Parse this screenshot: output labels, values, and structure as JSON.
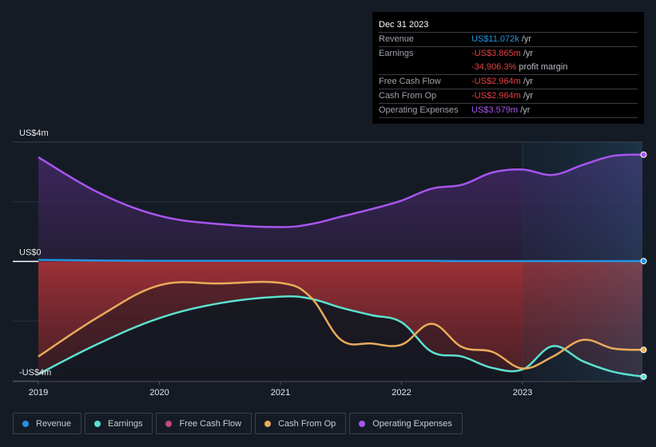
{
  "tooltip": {
    "date": "Dec 31 2023",
    "rows": [
      {
        "label": "Revenue",
        "value": "US$11.072k",
        "suffix": " /yr",
        "color": "#2394df"
      },
      {
        "label": "Earnings",
        "value": "-US$3.865m",
        "suffix": " /yr",
        "color": "#e64141"
      },
      {
        "label": "",
        "value": "-34,906.3%",
        "suffix": " profit margin",
        "color": "#e64141"
      },
      {
        "label": "Free Cash Flow",
        "value": "-US$2.964m",
        "suffix": " /yr",
        "color": "#e64141"
      },
      {
        "label": "Cash From Op",
        "value": "-US$2.964m",
        "suffix": " /yr",
        "color": "#e64141"
      },
      {
        "label": "Operating Expenses",
        "value": "US$3.579m",
        "suffix": " /yr",
        "color": "#a855f0"
      }
    ]
  },
  "legend": [
    {
      "label": "Revenue",
      "color": "#2394df"
    },
    {
      "label": "Earnings",
      "color": "#5ce1d0"
    },
    {
      "label": "Free Cash Flow",
      "color": "#c4467f"
    },
    {
      "label": "Cash From Op",
      "color": "#e9ac5b"
    },
    {
      "label": "Operating Expenses",
      "color": "#a855f0"
    }
  ],
  "chart_data": {
    "type": "area",
    "title": "",
    "xlabel": "",
    "ylabel": "",
    "ylim": [
      -4,
      4
    ],
    "yunit": "US$ millions",
    "y_tick_labels": [
      {
        "value": 4,
        "label": "US$4m"
      },
      {
        "value": 0,
        "label": "US$0"
      },
      {
        "value": -4,
        "label": "-US$4m"
      }
    ],
    "xlim": [
      2019,
      2024
    ],
    "x_tick_labels": [
      "2019",
      "2020",
      "2021",
      "2022",
      "2023"
    ],
    "x_tick_values": [
      2019,
      2020,
      2021,
      2022,
      2023
    ],
    "grid": true,
    "highlight_from": 2023,
    "x": [
      2019.0,
      2019.5,
      2020.0,
      2020.5,
      2021.0,
      2021.25,
      2021.5,
      2021.75,
      2022.0,
      2022.25,
      2022.5,
      2022.75,
      2023.0,
      2023.25,
      2023.5,
      2023.75,
      2024.0
    ],
    "series": [
      {
        "name": "Revenue",
        "color": "#2394df",
        "values": [
          0.05,
          0.03,
          0.02,
          0.02,
          0.02,
          0.02,
          0.02,
          0.02,
          0.02,
          0.02,
          0.01,
          0.01,
          0.01,
          0.01,
          0.01,
          0.01,
          0.011
        ]
      },
      {
        "name": "Earnings",
        "color": "#5ce1d0",
        "values": [
          -3.78,
          -2.75,
          -1.9,
          -1.4,
          -1.18,
          -1.25,
          -1.55,
          -1.8,
          -2.04,
          -3.03,
          -3.19,
          -3.57,
          -3.62,
          -2.84,
          -3.35,
          -3.7,
          -3.865
        ]
      },
      {
        "name": "Free Cash Flow",
        "color": "#c4467f",
        "values": [
          -3.19,
          -1.85,
          -0.8,
          -0.74,
          -0.72,
          -1.2,
          -2.63,
          -2.75,
          -2.79,
          -2.09,
          -2.87,
          -3.03,
          -3.59,
          -3.19,
          -2.63,
          -2.92,
          -2.964
        ]
      },
      {
        "name": "Cash From Op",
        "color": "#e9ac5b",
        "values": [
          -3.19,
          -1.85,
          -0.8,
          -0.74,
          -0.72,
          -1.2,
          -2.63,
          -2.75,
          -2.79,
          -2.09,
          -2.87,
          -3.03,
          -3.59,
          -3.19,
          -2.63,
          -2.92,
          -2.964
        ]
      },
      {
        "name": "Operating Expenses",
        "color": "#a855f0",
        "values": [
          3.49,
          2.3,
          1.53,
          1.25,
          1.15,
          1.25,
          1.5,
          1.75,
          2.04,
          2.44,
          2.57,
          2.98,
          3.08,
          2.9,
          3.24,
          3.54,
          3.579
        ]
      }
    ]
  }
}
